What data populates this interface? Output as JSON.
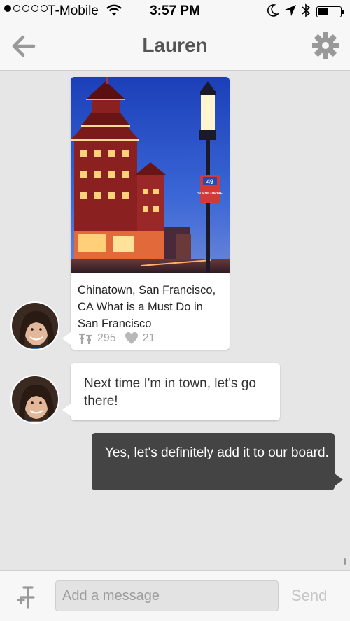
{
  "status_bar": {
    "carrier": "T-Mobile",
    "time": "3:57 PM",
    "signal_bars_filled": 1,
    "signal_bars_total": 5,
    "battery_level_percent": 40
  },
  "nav": {
    "title": "Lauren",
    "back_icon": "arrow-left-icon",
    "settings_icon": "gear-icon"
  },
  "messages": [
    {
      "type": "pin",
      "from": "Lauren",
      "description": "Chinatown, San Francisco, CA What is a Must Do in San Francisco",
      "repins": "295",
      "likes": "21",
      "image_sign_number": "49",
      "image_sign_text": "SCENIC DRIVE"
    },
    {
      "type": "text",
      "from": "Lauren",
      "text": "Next time I'm in town, let's go there!"
    },
    {
      "type": "text",
      "from": "me",
      "text": "Yes, let's definitely add it to our board."
    }
  ],
  "composer": {
    "placeholder": "Add a message",
    "send_label": "Send",
    "pin_icon": "pin-icon"
  },
  "colors": {
    "background": "#e6e6e6",
    "outgoing_bubble": "#444444",
    "incoming_bubble": "#ffffff",
    "send_disabled": "#c6c6c6"
  }
}
